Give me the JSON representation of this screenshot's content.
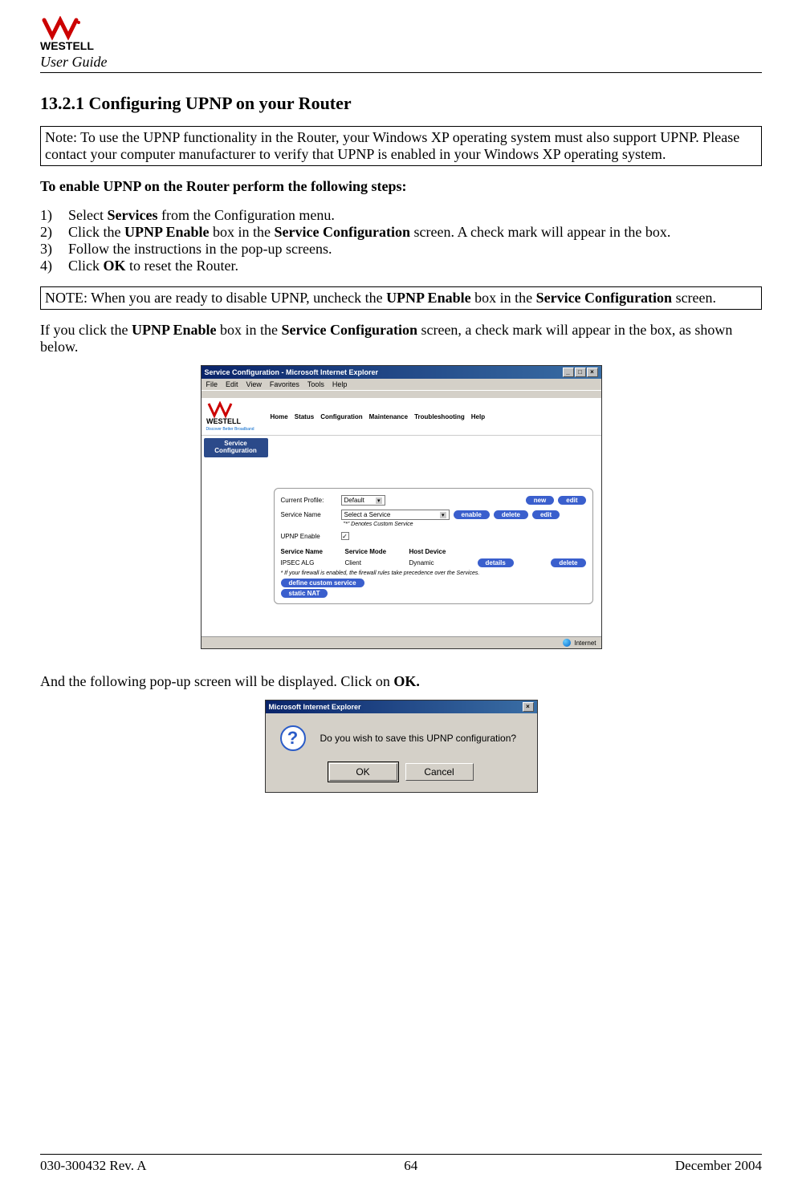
{
  "header": {
    "brand": "WESTELL",
    "user_guide": "User Guide"
  },
  "section_title": "13.2.1 Configuring UPNP on your Router",
  "note1": "Note: To use the UPNP functionality in the Router, your Windows XP operating system must also support UPNP. Please contact your computer manufacturer to verify that UPNP is enabled in your Windows XP operating system.",
  "steps_intro": "To enable UPNP on the Router perform the following steps:",
  "steps": [
    {
      "n": "1)",
      "pre": "Select ",
      "b1": "Services",
      "post": " from the Configuration menu."
    },
    {
      "n": "2)",
      "pre": "Click the ",
      "b1": "UPNP Enable",
      "mid": " box in the ",
      "b2": "Service Configuration",
      "post": " screen. A check mark will appear in the box."
    },
    {
      "n": "3)",
      "pre": "Follow the instructions in the pop-up screens."
    },
    {
      "n": "4)",
      "pre": "Click ",
      "b1": "OK",
      "post": " to reset the Router."
    }
  ],
  "note2_pre": "NOTE: When you are ready to disable UPNP, uncheck the ",
  "note2_b1": "UPNP Enable",
  "note2_mid": " box in the ",
  "note2_b2": "Service Configuration",
  "note2_post": " screen.",
  "para_pre": "If you click the ",
  "para_b1": "UPNP Enable",
  "para_mid": " box in the ",
  "para_b2": "Service Configuration",
  "para_post": " screen, a check mark will appear in the box, as shown below.",
  "screenshot1": {
    "title": "Service Configuration - Microsoft Internet Explorer",
    "menubar": [
      "File",
      "Edit",
      "View",
      "Favorites",
      "Tools",
      "Help"
    ],
    "brand": "WESTELL",
    "tagline": "Discover Better Broadband",
    "nav": [
      "Home",
      "Status",
      "Configuration",
      "Maintenance",
      "Troubleshooting",
      "Help"
    ],
    "sidebar_tab": "Service Configuration",
    "current_profile_label": "Current Profile:",
    "current_profile_value": "Default",
    "service_name_label": "Service Name",
    "service_name_value": "Select a Service",
    "denotes": "\"*\" Denotes Custom Service",
    "upnp_enable_label": "UPNP Enable",
    "upnp_checked": "✓",
    "buttons": {
      "new": "new",
      "edit1": "edit",
      "enable": "enable",
      "delete1": "delete",
      "edit2": "edit",
      "details": "details",
      "delete2": "delete",
      "define": "define custom service",
      "static": "static NAT"
    },
    "table_headers": {
      "c1": "Service Name",
      "c2": "Service Mode",
      "c3": "Host Device"
    },
    "table_row": {
      "c1": "IPSEC ALG",
      "c2": "Client",
      "c3": "Dynamic"
    },
    "fw_note": "* If your firewall is enabled, the firewall rules take precedence over the Services.",
    "status": "Internet"
  },
  "para2_pre": "And the following pop-up screen will be displayed. Click on ",
  "para2_b1": "OK.",
  "dialog": {
    "title": "Microsoft Internet Explorer",
    "question": "?",
    "text": "Do you wish to save this UPNP configuration?",
    "ok": "OK",
    "cancel": "Cancel"
  },
  "footer": {
    "left": "030-300432 Rev. A",
    "center": "64",
    "right": "December 2004"
  }
}
